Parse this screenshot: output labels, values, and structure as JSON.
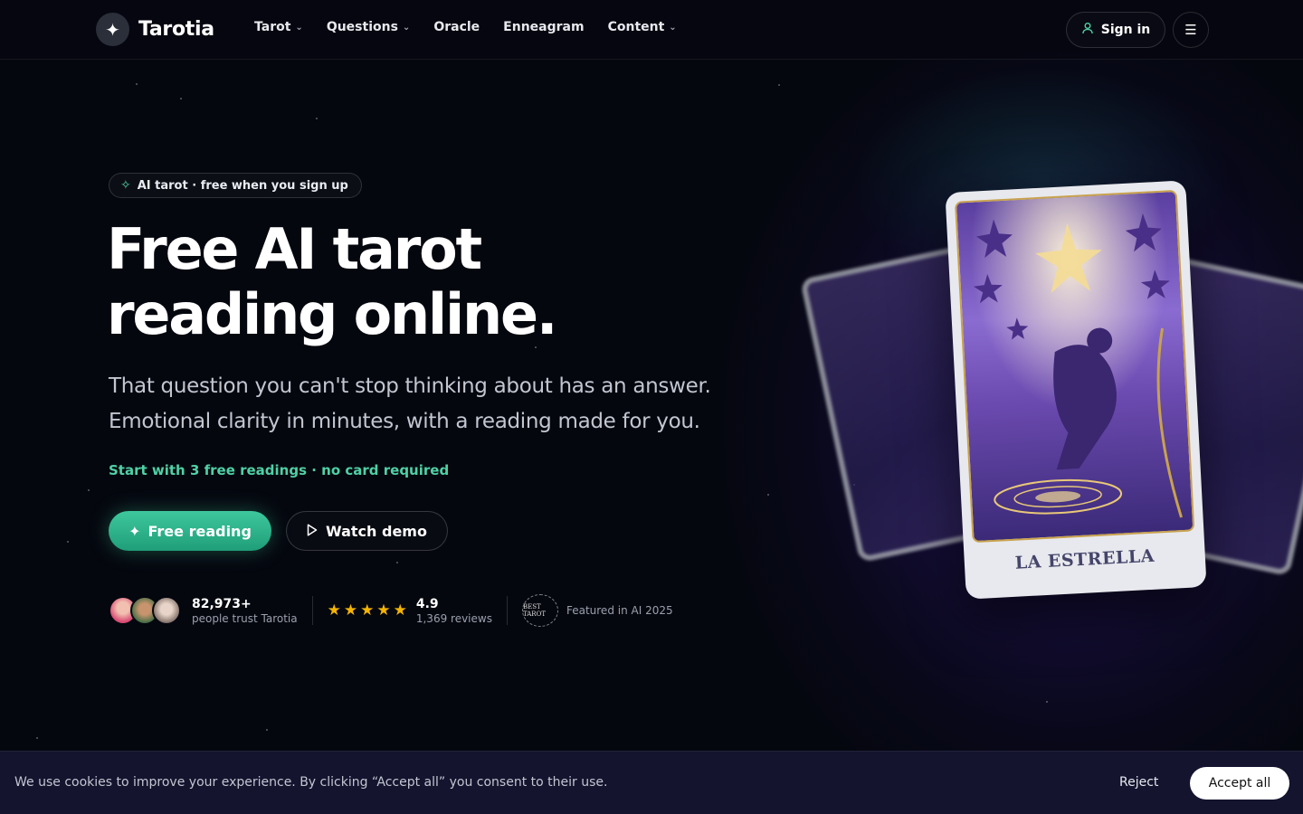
{
  "brand": {
    "name": "Tarotia",
    "logo_icon": "sparkle-icon"
  },
  "nav": [
    {
      "label": "Tarot",
      "has_dropdown": true
    },
    {
      "label": "Questions",
      "has_dropdown": true
    },
    {
      "label": "Oracle",
      "has_dropdown": false
    },
    {
      "label": "Enneagram",
      "has_dropdown": false
    },
    {
      "label": "Content",
      "has_dropdown": true
    }
  ],
  "header": {
    "signin_label": "Sign in",
    "menu_icon": "hamburger-icon"
  },
  "hero": {
    "badge": "AI tarot · free when you sign up",
    "title_line1": "Free AI tarot",
    "title_line2": "reading online.",
    "subtitle_line1": "That question you can't stop thinking about has an answer.",
    "subtitle_line2": "Emotional clarity in minutes, with a reading made for you.",
    "promo": "Start with 3 free readings · no card required",
    "primary_cta": "Free reading",
    "secondary_cta": "Watch demo"
  },
  "social_proof": {
    "users_count": "82,973+",
    "users_label": "people trust Tarotia",
    "rating_value": "4.9",
    "star_count": 5,
    "reviews": "1,369 reviews",
    "award_text": "BEST TAROT",
    "featured": "Featured in AI 2025"
  },
  "card": {
    "name": "LA ESTRELLA"
  },
  "cookie": {
    "message": "We use cookies to improve your experience. By clicking “Accept all” you consent to their use.",
    "reject_label": "Reject",
    "accept_label": "Accept all"
  },
  "colors": {
    "accent": "#4fd1a5",
    "background": "#05070f",
    "star_rating": "#f5b400"
  }
}
